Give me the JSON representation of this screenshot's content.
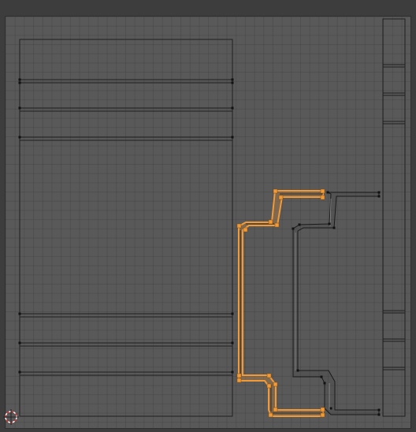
{
  "editor": {
    "type": "uv-editor-viewport",
    "background_color": "#595959",
    "frame_color": "#3d3d3d",
    "selection_color": "#f29a38",
    "edge_color": "#1e1e1e",
    "unselected_vertex_color": "#111111"
  },
  "cursor": {
    "icon": "2d-cursor-icon"
  }
}
